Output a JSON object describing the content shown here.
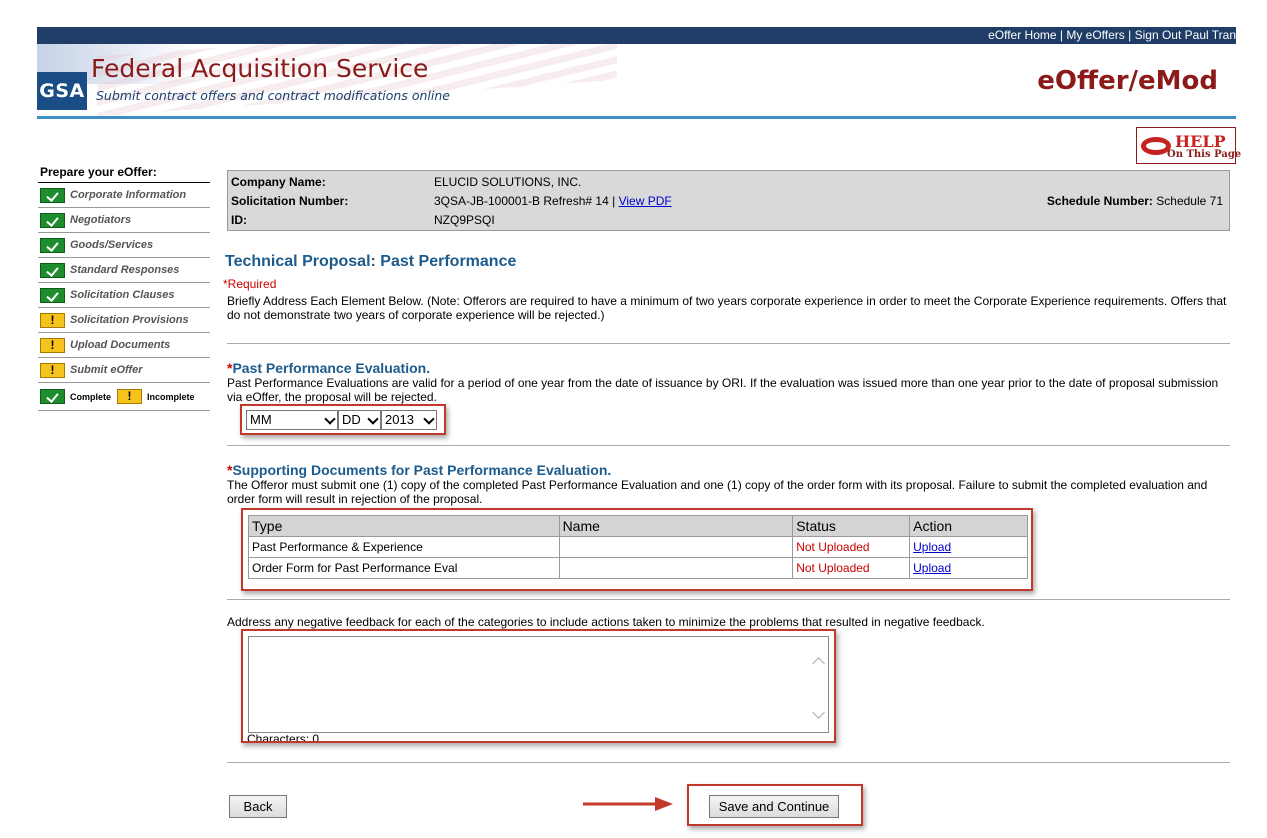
{
  "header": {
    "top_links": [
      "eOffer Home",
      "My eOffers",
      "Sign Out Paul Tran"
    ],
    "logo_text": "GSA",
    "org_title": "Federal Acquisition Service",
    "org_subtitle": "Submit contract offers and contract modifications online",
    "brand": "eOffer/eMod",
    "colors": {
      "top_bar": "#1f3d66",
      "brand": "#8b1a1a",
      "rule": "#3d8ec4"
    }
  },
  "help": {
    "label": "HELP",
    "sublabel": "On This Page"
  },
  "sidebar": {
    "title": "Prepare your eOffer:",
    "items": [
      {
        "label": "Corporate Information",
        "status": "complete"
      },
      {
        "label": "Negotiators",
        "status": "complete"
      },
      {
        "label": "Goods/Services",
        "status": "complete"
      },
      {
        "label": "Standard Responses",
        "status": "complete"
      },
      {
        "label": "Solicitation Clauses",
        "status": "complete"
      },
      {
        "label": "Solicitation Provisions",
        "status": "incomplete"
      },
      {
        "label": "Upload Documents",
        "status": "incomplete"
      },
      {
        "label": "Submit eOffer",
        "status": "incomplete"
      }
    ],
    "legend": {
      "complete": "Complete",
      "incomplete": "Incomplete"
    }
  },
  "info": {
    "company_label": "Company Name:",
    "company_value": "ELUCID SOLUTIONS, INC.",
    "solicitation_label": "Solicitation Number:",
    "solicitation_value": "3QSA-JB-100001-B Refresh# 14 |",
    "view_pdf": "View PDF",
    "id_label": "ID:",
    "id_value": "NZQ9PSQI",
    "schedule_label": "Schedule Number:",
    "schedule_value": "Schedule 71"
  },
  "main": {
    "title": "Technical Proposal: Past Performance",
    "required": "*Required",
    "intro": "Briefly Address Each Element Below. (Note: Offerors are required to have a minimum of two years corporate experience in order to meet the Corporate Experience requirements. Offers that do not demonstrate two years of corporate experience will be rejected.)",
    "ppe": {
      "star": "*",
      "title": "Past Performance Evaluation.",
      "text": "Past Performance Evaluations are valid for a period of one year from the date of issuance by ORI. If the evaluation was issued more than one year prior to the date of proposal submission via eOffer, the proposal will be rejected.",
      "month": "MM",
      "day": "DD",
      "year": "2013"
    },
    "docs": {
      "star": "*",
      "title": "Supporting Documents for Past Performance Evaluation.",
      "text": "The Offeror must submit one (1) copy of the completed Past Performance Evaluation and one (1) copy of the order form with its proposal. Failure to submit the completed evaluation and order form will result in rejection of the proposal.",
      "columns": [
        "Type",
        "Name",
        "Status",
        "Action"
      ],
      "rows": [
        {
          "type": "Past Performance & Experience",
          "name": "",
          "status": "Not Uploaded",
          "action": "Upload"
        },
        {
          "type": "Order Form for Past Performance Eval",
          "name": "",
          "status": "Not Uploaded",
          "action": "Upload"
        }
      ]
    },
    "feedback": {
      "label": "Address any negative feedback for each of the categories to include actions taken to minimize the problems that resulted in negative feedback.",
      "value": "",
      "chars": "Characters: 0"
    }
  },
  "buttons": {
    "back": "Back",
    "save": "Save and Continue"
  }
}
